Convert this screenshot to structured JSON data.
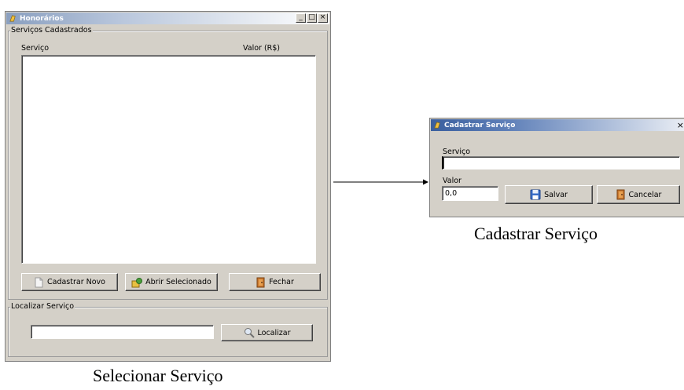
{
  "main_window": {
    "title": "Honorários",
    "controls": {
      "minimize": "_",
      "maximize": "□",
      "close": "×"
    },
    "services_group": {
      "label": "Serviços Cadastrados",
      "columns": [
        "Serviço",
        "Valor (R$)"
      ],
      "rows": []
    },
    "buttons": {
      "new": "Cadastrar Novo",
      "open": "Abrir Selecionado",
      "close": "Fechar"
    },
    "search_group": {
      "label": "Localizar Serviço",
      "input_value": "",
      "button": "Localizar"
    }
  },
  "dialog": {
    "title": "Cadastrar Serviço",
    "close": "×",
    "service_label": "Serviço",
    "service_value": "",
    "value_label": "Valor",
    "value_value": "0,0",
    "save": "Salvar",
    "cancel": "Cancelar"
  },
  "captions": {
    "left": "Selecionar Serviço",
    "right": "Cadastrar Serviço"
  },
  "colors": {
    "window_bg": "#d4d0c8",
    "titlebar_active": "#3a5f9e",
    "titlebar_inactive": "#8a9fbf"
  }
}
